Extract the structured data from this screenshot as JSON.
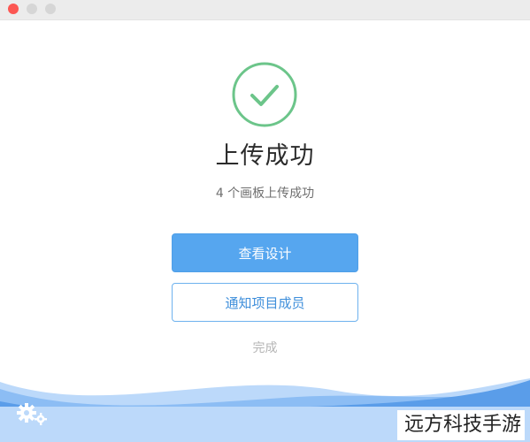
{
  "dialog": {
    "title": "上传成功",
    "subtitle": "4 个画板上传成功",
    "primary_button": "查看设计",
    "secondary_button": "通知项目成员",
    "done_link": "完成"
  },
  "watermark": "远方科技手游",
  "colors": {
    "success_green": "#6cc58a",
    "primary_blue": "#56a6ef",
    "wave_light": "#bcd9fa",
    "wave_mid": "#8cbdf4",
    "wave_dark": "#5a9de9"
  },
  "icons": {
    "check": "check-circle-icon",
    "settings": "gears-icon"
  }
}
